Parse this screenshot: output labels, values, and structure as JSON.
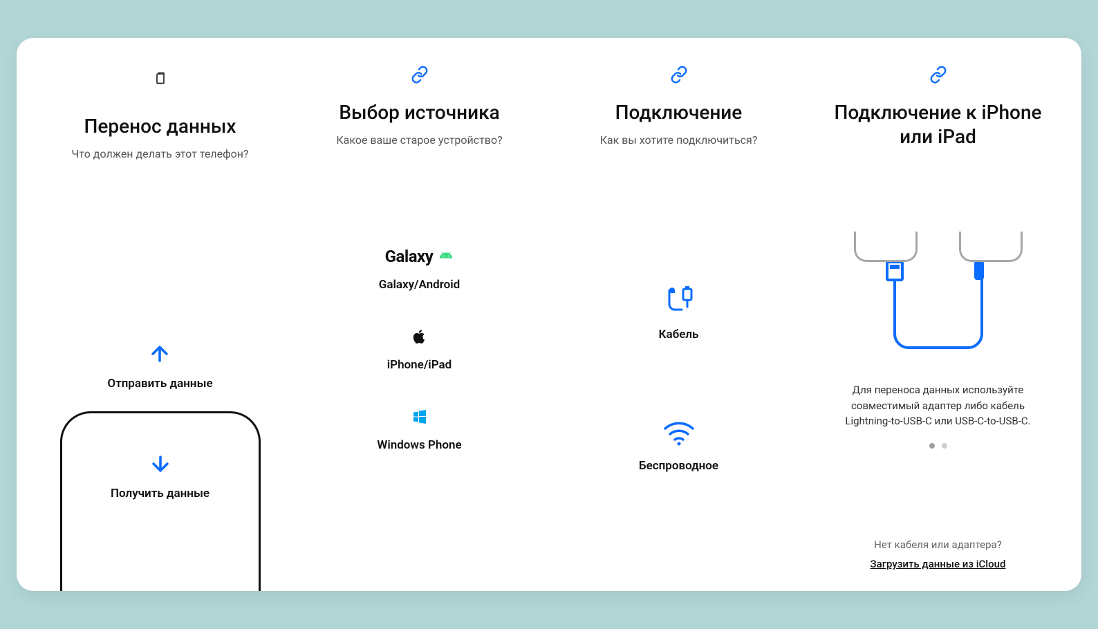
{
  "col1": {
    "title": "Перенос данных",
    "subtitle": "Что должен делать этот телефон?",
    "send_label": "Отправить данные",
    "receive_label": "Получить данные"
  },
  "col2": {
    "title": "Выбор источника",
    "subtitle": "Какое ваше старое устройство?",
    "items": [
      {
        "logo_text": "Galaxy",
        "label": "Galaxy/Android"
      },
      {
        "label": "iPhone/iPad"
      },
      {
        "label": "Windows Phone"
      }
    ]
  },
  "col3": {
    "title": "Подключение",
    "subtitle": "Как вы хотите подключиться?",
    "items": [
      {
        "label": "Кабель"
      },
      {
        "label": "Беспроводное"
      }
    ]
  },
  "col4": {
    "title": "Подключение к iPhone или iPad",
    "instruction": "Для переноса данных используйте совместимый адаптер либо кабель Lightning-to-USB-C или USB-C-to-USB-C.",
    "page_dots": {
      "total": 2,
      "active": 0
    },
    "footer_question": "Нет кабеля или адаптера?",
    "footer_link": "Загрузить данные из iCloud"
  }
}
